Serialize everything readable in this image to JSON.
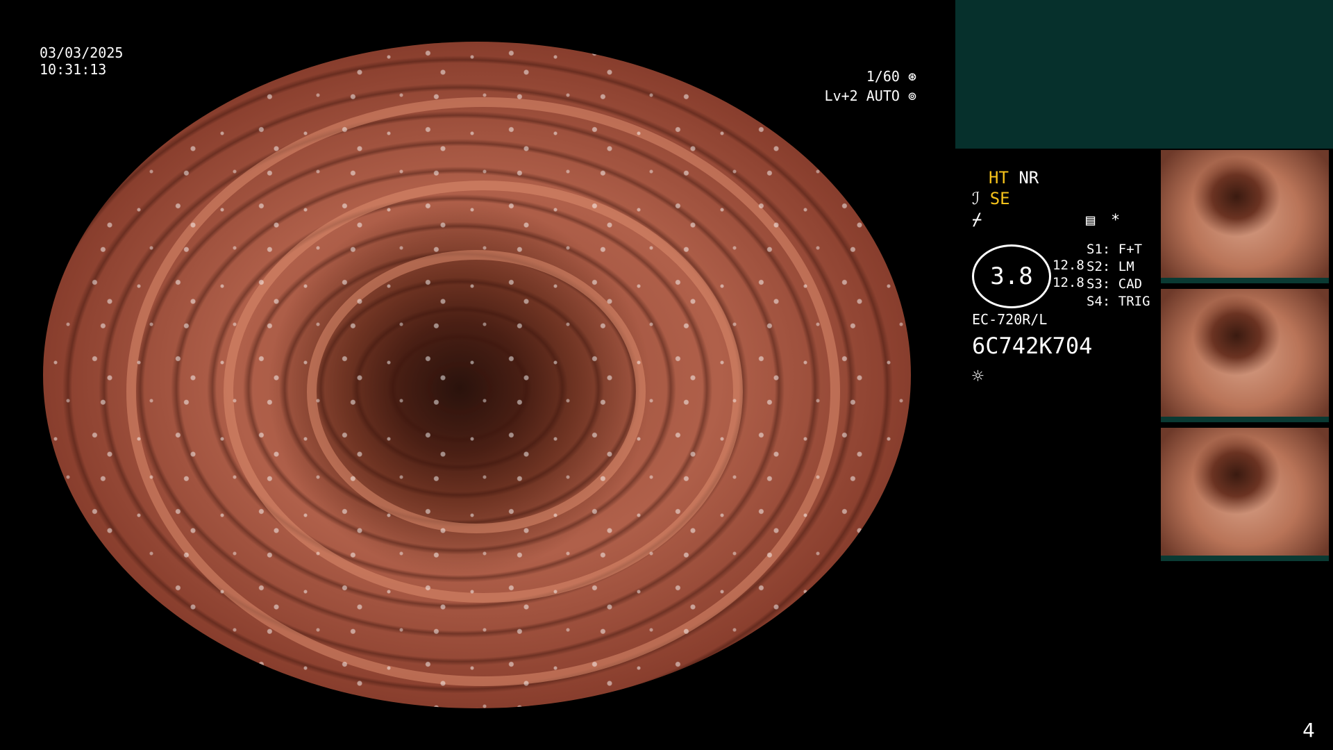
{
  "osd": {
    "date": "03/03/2025",
    "time": "10:31:13",
    "shutter": "1/60",
    "iris": "Lv+2 AUTO"
  },
  "side_panel": {
    "ht": "HT",
    "nr": "NR",
    "se": "SE",
    "gauge_value": "3.8",
    "values": [
      "12.8",
      "12.8"
    ],
    "switches": [
      {
        "key": "S1:",
        "value": "F+T"
      },
      {
        "key": "S2:",
        "value": "LM"
      },
      {
        "key": "S3:",
        "value": "CAD"
      },
      {
        "key": "S4:",
        "value": "TRIG"
      }
    ],
    "scope_model": "EC-720R/L",
    "serial": "6C742K704",
    "asterisk": "*"
  },
  "page_number": "4",
  "icons": {
    "shutter": "aperture-icon",
    "iris": "iris-icon",
    "enhancement": "enhancement-icon",
    "flash": "freeze-icon",
    "record": "record-icon",
    "light": "light-icon"
  },
  "colors": {
    "accent": "#f5c21b",
    "panel": "#06302c"
  }
}
